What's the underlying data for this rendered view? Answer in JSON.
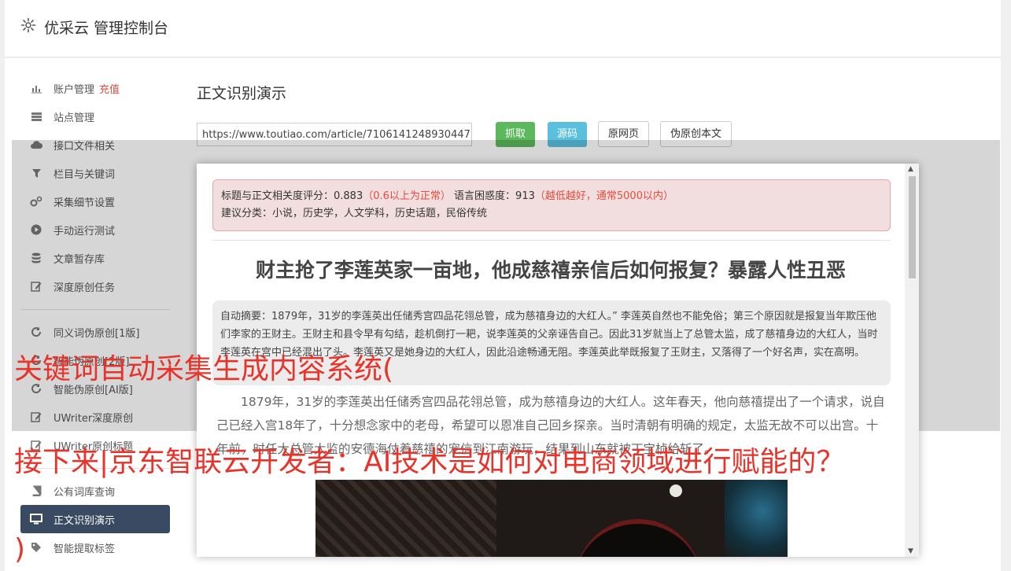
{
  "app": {
    "title": "优采云 管理控制台"
  },
  "sidebar": {
    "group1": [
      {
        "label": "账户管理",
        "badge": "充值",
        "icon": "bar-chart-icon"
      },
      {
        "label": "站点管理",
        "icon": "server-icon"
      },
      {
        "label": "接口文件相关",
        "icon": "cloud-upload-icon"
      },
      {
        "label": "栏目与关键词",
        "icon": "filter-icon"
      },
      {
        "label": "采集细节设置",
        "icon": "gears-icon"
      },
      {
        "label": "手动运行测试",
        "icon": "play-icon"
      },
      {
        "label": "文章暂存库",
        "icon": "database-icon"
      },
      {
        "label": "深度原创任务",
        "icon": "edit-icon"
      }
    ],
    "group2": [
      {
        "label": "同义词伪原创[1版]",
        "icon": "refresh-icon"
      },
      {
        "label": "智能伪原创[2版]",
        "icon": "refresh-icon"
      },
      {
        "label": "智能伪原创[AI版]",
        "icon": "refresh-icon"
      },
      {
        "label": "UWriter深度原创",
        "icon": "edit-icon"
      },
      {
        "label": "UWriter原创标题",
        "icon": "edit-icon"
      }
    ],
    "group3": [
      {
        "label": "公有词库查询",
        "icon": "book-icon"
      },
      {
        "label": "正文识别演示",
        "icon": "monitor-icon",
        "active": true
      },
      {
        "label": "智能提取标签",
        "icon": "tag-icon"
      }
    ]
  },
  "content": {
    "heading": "正文识别演示",
    "url_value": "https://www.toutiao.com/article/7106141248930447",
    "buttons": {
      "fetch": "抓取",
      "source": "源码",
      "original": "原网页",
      "pseudo": "伪原创本文"
    }
  },
  "result": {
    "relevance_label": "标题与正文相关度评分：0.883",
    "relevance_note": "（0.6以上为正常）",
    "confusion_label": "语言困惑度：913",
    "confusion_note": "（越低越好，通常5000以内）",
    "category": "建议分类：小说，历史学，人文学科，历史话题，民俗传统",
    "title": "财主抢了李莲英家一亩地，他成慈禧亲信后如何报复？暴露人性丑恶",
    "summary": "自动摘要：1879年，31岁的李莲英出任储秀宫四品花翎总管，成为慈禧身边的大红人。” 李莲英自然也不能免俗；第三个原因就是报复当年欺压他们李家的王财主。王财主和县令早有勾结，趁机倒打一耙，说李莲英的父亲诬告自己。因此31岁就当上了总管太监，成了慈禧身边的大红人，当时李莲英在宫中已经混出了头。李莲英又是她身边的大红人，因此沿途畅通无阻。李莲英此举既报复了王财主，又落得了一个好名声，实在高明。",
    "paragraph": "1879年，31岁的李莲英出任储秀宫四品花翎总管，成为慈禧身边的大红人。这年春天，他向慈禧提出了一个请求，说自己已经入宫18年了，十分想念家中的老母，希望可以恩准自己回乡探亲。当时清朝有明确的规定，太监无故不可以出宫。十年前，时任大总管太监的安德海仗着慈禧的宠信到江南游玩，结果到山东就被丁宝桢给斩了。"
  },
  "watermark": {
    "line1": "关键词自动采集生成内容系统(",
    "line2": "接下来|京东智联云开发者：AI技术是如何对电商领域进行赋能的？",
    "line3": ")"
  }
}
